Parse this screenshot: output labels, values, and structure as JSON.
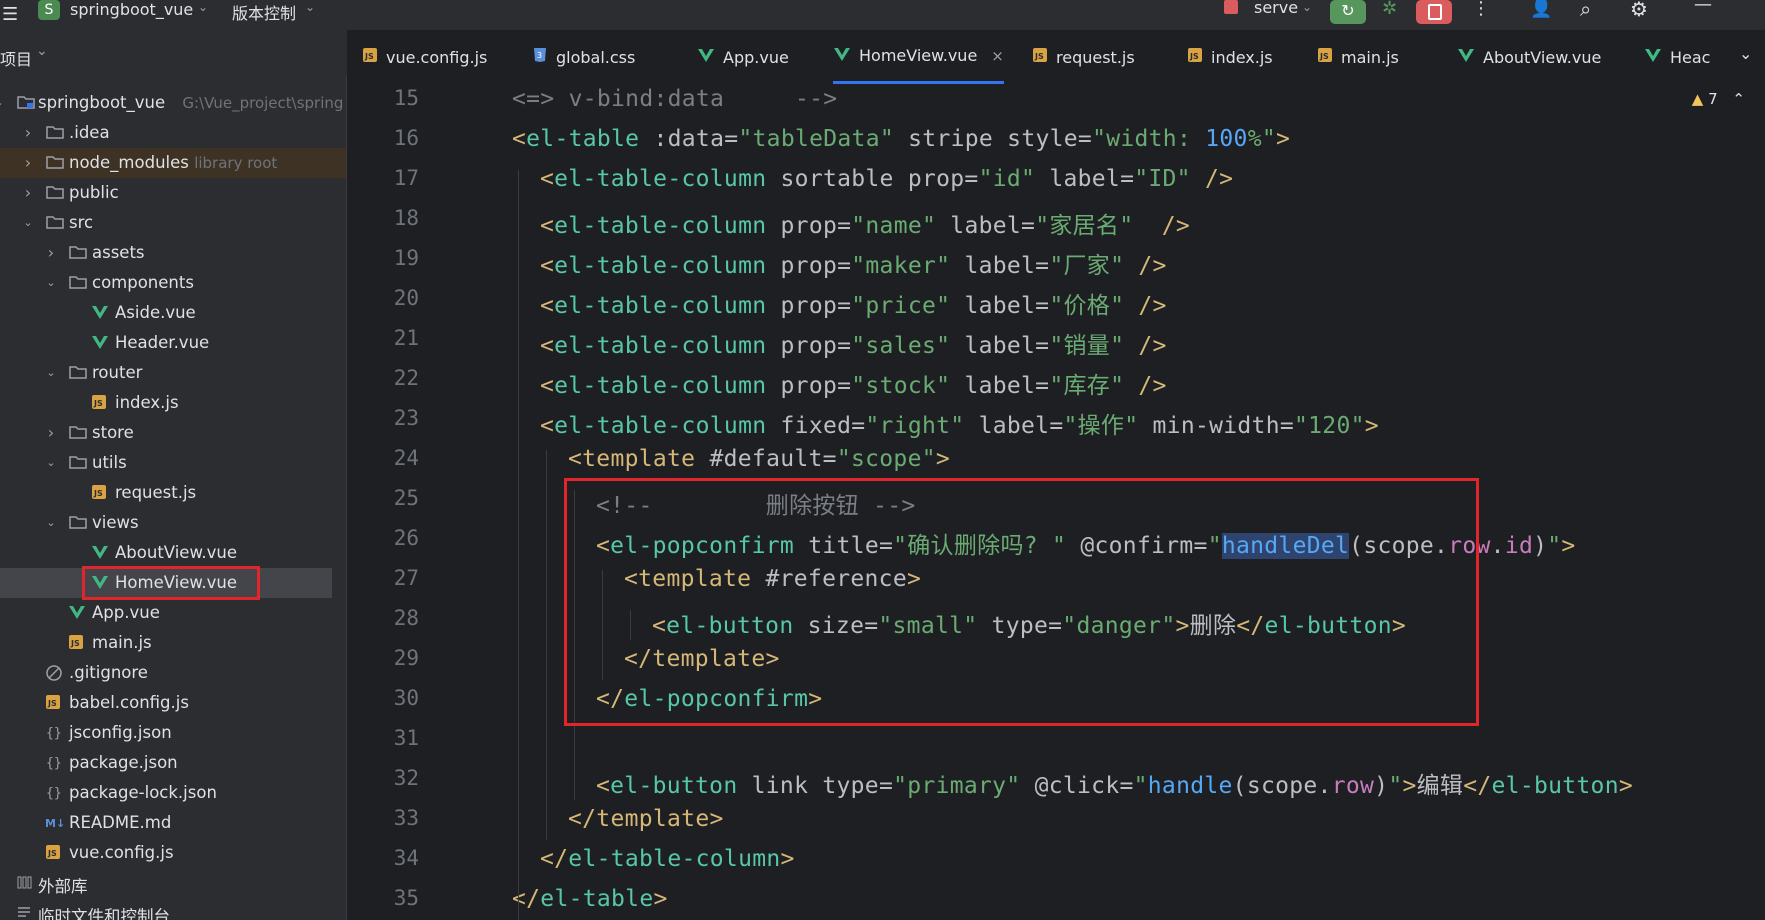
{
  "titlebar": {
    "project_badge": "S",
    "project_name": "springboot_vue",
    "vcs_label": "版本控制",
    "run_config": "serve"
  },
  "panel": {
    "title": "项目"
  },
  "tabs": [
    {
      "label": "vue.config.js",
      "icon": "js"
    },
    {
      "label": "global.css",
      "icon": "css"
    },
    {
      "label": "App.vue",
      "icon": "vue"
    },
    {
      "label": "HomeView.vue",
      "icon": "vue",
      "active": true
    },
    {
      "label": "request.js",
      "icon": "js"
    },
    {
      "label": "index.js",
      "icon": "js"
    },
    {
      "label": "main.js",
      "icon": "js"
    },
    {
      "label": "AboutView.vue",
      "icon": "vue"
    },
    {
      "label": "Heac",
      "icon": "vue"
    }
  ],
  "tree": [
    {
      "label": "springboot_vue",
      "hint": "G:\\Vue_project\\spring",
      "icon": "module",
      "depth": 0,
      "chev": "open"
    },
    {
      "label": ".idea",
      "icon": "folder",
      "depth": 1,
      "chev": "closed"
    },
    {
      "label": "node_modules",
      "hint": "library root",
      "icon": "folder",
      "depth": 1,
      "chev": "closed",
      "excluded": true
    },
    {
      "label": "public",
      "icon": "folder",
      "depth": 1,
      "chev": "closed"
    },
    {
      "label": "src",
      "icon": "folder",
      "depth": 1,
      "chev": "open"
    },
    {
      "label": "assets",
      "icon": "folder",
      "depth": 2,
      "chev": "closed"
    },
    {
      "label": "components",
      "icon": "folder",
      "depth": 2,
      "chev": "open"
    },
    {
      "label": "Aside.vue",
      "icon": "vue",
      "depth": 3
    },
    {
      "label": "Header.vue",
      "icon": "vue",
      "depth": 3
    },
    {
      "label": "router",
      "icon": "folder",
      "depth": 2,
      "chev": "open"
    },
    {
      "label": "index.js",
      "icon": "js",
      "depth": 3
    },
    {
      "label": "store",
      "icon": "folder",
      "depth": 2,
      "chev": "closed"
    },
    {
      "label": "utils",
      "icon": "folder",
      "depth": 2,
      "chev": "open"
    },
    {
      "label": "request.js",
      "icon": "js",
      "depth": 3
    },
    {
      "label": "views",
      "icon": "folder",
      "depth": 2,
      "chev": "open"
    },
    {
      "label": "AboutView.vue",
      "icon": "vue",
      "depth": 3
    },
    {
      "label": "HomeView.vue",
      "icon": "vue",
      "depth": 3,
      "selected": true
    },
    {
      "label": "App.vue",
      "icon": "vue",
      "depth": 2
    },
    {
      "label": "main.js",
      "icon": "js",
      "depth": 2
    },
    {
      "label": ".gitignore",
      "icon": "ignore",
      "depth": 1
    },
    {
      "label": "babel.config.js",
      "icon": "js",
      "depth": 1
    },
    {
      "label": "jsconfig.json",
      "icon": "json",
      "depth": 1
    },
    {
      "label": "package.json",
      "icon": "json",
      "depth": 1
    },
    {
      "label": "package-lock.json",
      "icon": "json",
      "depth": 1
    },
    {
      "label": "README.md",
      "icon": "md",
      "depth": 1
    },
    {
      "label": "vue.config.js",
      "icon": "js",
      "depth": 1
    },
    {
      "label": "外部库",
      "icon": "lib",
      "depth": 0
    },
    {
      "label": "临时文件和控制台",
      "icon": "scratch",
      "depth": 0
    }
  ],
  "editor": {
    "warnings": "7",
    "lines": [
      {
        "n": "15",
        "indent": 0,
        "tokens": [
          [
            "c-cm",
            "<=> v-bind:data     -->"
          ]
        ]
      },
      {
        "n": "16",
        "indent": 0,
        "tokens": [
          [
            "c-tag",
            "<"
          ],
          [
            "c-el",
            "el-table"
          ],
          [
            "c-attr",
            " :data="
          ],
          [
            "c-str",
            "\"tableData\""
          ],
          [
            "c-attr",
            " stripe style="
          ],
          [
            "c-str",
            "\"width: "
          ],
          [
            "c-kw",
            "100"
          ],
          [
            "c-str",
            "%\""
          ],
          [
            "c-tag",
            ">"
          ]
        ]
      },
      {
        "n": "17",
        "indent": 1,
        "tokens": [
          [
            "c-tag",
            "<"
          ],
          [
            "c-el",
            "el-table-column"
          ],
          [
            "c-attr",
            " sortable prop="
          ],
          [
            "c-str",
            "\"id\""
          ],
          [
            "c-attr",
            " label="
          ],
          [
            "c-str",
            "\"ID\""
          ],
          [
            "c-attr",
            " "
          ],
          [
            "c-tag",
            "/>"
          ]
        ]
      },
      {
        "n": "18",
        "indent": 1,
        "tokens": [
          [
            "c-tag",
            "<"
          ],
          [
            "c-el",
            "el-table-column"
          ],
          [
            "c-attr",
            " prop="
          ],
          [
            "c-str",
            "\"name\""
          ],
          [
            "c-attr",
            " label="
          ],
          [
            "c-str",
            "\"家居名\""
          ],
          [
            "c-attr",
            "  "
          ],
          [
            "c-tag",
            "/>"
          ]
        ]
      },
      {
        "n": "19",
        "indent": 1,
        "tokens": [
          [
            "c-tag",
            "<"
          ],
          [
            "c-el",
            "el-table-column"
          ],
          [
            "c-attr",
            " prop="
          ],
          [
            "c-str",
            "\"maker\""
          ],
          [
            "c-attr",
            " label="
          ],
          [
            "c-str",
            "\"厂家\""
          ],
          [
            "c-attr",
            " "
          ],
          [
            "c-tag",
            "/>"
          ]
        ]
      },
      {
        "n": "20",
        "indent": 1,
        "tokens": [
          [
            "c-tag",
            "<"
          ],
          [
            "c-el",
            "el-table-column"
          ],
          [
            "c-attr",
            " prop="
          ],
          [
            "c-str",
            "\"price\""
          ],
          [
            "c-attr",
            " label="
          ],
          [
            "c-str",
            "\"价格\""
          ],
          [
            "c-attr",
            " "
          ],
          [
            "c-tag",
            "/>"
          ]
        ]
      },
      {
        "n": "21",
        "indent": 1,
        "tokens": [
          [
            "c-tag",
            "<"
          ],
          [
            "c-el",
            "el-table-column"
          ],
          [
            "c-attr",
            " prop="
          ],
          [
            "c-str",
            "\"sales\""
          ],
          [
            "c-attr",
            " label="
          ],
          [
            "c-str",
            "\"销量\""
          ],
          [
            "c-attr",
            " "
          ],
          [
            "c-tag",
            "/>"
          ]
        ]
      },
      {
        "n": "22",
        "indent": 1,
        "tokens": [
          [
            "c-tag",
            "<"
          ],
          [
            "c-el",
            "el-table-column"
          ],
          [
            "c-attr",
            " prop="
          ],
          [
            "c-str",
            "\"stock\""
          ],
          [
            "c-attr",
            " label="
          ],
          [
            "c-str",
            "\"库存\""
          ],
          [
            "c-attr",
            " "
          ],
          [
            "c-tag",
            "/>"
          ]
        ]
      },
      {
        "n": "23",
        "indent": 1,
        "tokens": [
          [
            "c-tag",
            "<"
          ],
          [
            "c-el",
            "el-table-column"
          ],
          [
            "c-attr",
            " fixed="
          ],
          [
            "c-str",
            "\"right\""
          ],
          [
            "c-attr",
            " label="
          ],
          [
            "c-str",
            "\"操作\""
          ],
          [
            "c-attr",
            " min-width="
          ],
          [
            "c-str",
            "\"120\""
          ],
          [
            "c-tag",
            ">"
          ]
        ]
      },
      {
        "n": "24",
        "indent": 2,
        "tokens": [
          [
            "c-tag",
            "<"
          ],
          [
            "c-tag",
            "template"
          ],
          [
            "c-attr",
            " #default="
          ],
          [
            "c-str",
            "\"scope\""
          ],
          [
            "c-tag",
            ">"
          ]
        ]
      },
      {
        "n": "25",
        "indent": 3,
        "tokens": [
          [
            "c-cm",
            "<!--        删除按钮 -->"
          ]
        ]
      },
      {
        "n": "26",
        "indent": 3,
        "tokens": [
          [
            "c-tag",
            "<"
          ],
          [
            "c-el",
            "el-popconfirm"
          ],
          [
            "c-attr",
            " title="
          ],
          [
            "c-str",
            "\"确认删除吗? \""
          ],
          [
            "c-attr",
            " @confirm="
          ],
          [
            "c-str",
            "\""
          ],
          [
            "c-fn hl",
            "handleDel"
          ],
          [
            "c-attr",
            "(scope."
          ],
          [
            "c-pr",
            "row"
          ],
          [
            "c-attr",
            "."
          ],
          [
            "c-pr",
            "id"
          ],
          [
            "c-attr",
            ")"
          ],
          [
            "c-str",
            "\""
          ],
          [
            "c-tag",
            ">"
          ]
        ]
      },
      {
        "n": "27",
        "indent": 4,
        "tokens": [
          [
            "c-tag",
            "<"
          ],
          [
            "c-tag",
            "template"
          ],
          [
            "c-attr",
            " #reference"
          ],
          [
            "c-tag",
            ">"
          ]
        ]
      },
      {
        "n": "28",
        "indent": 5,
        "tokens": [
          [
            "c-tag",
            "<"
          ],
          [
            "c-el",
            "el-button"
          ],
          [
            "c-attr",
            " size="
          ],
          [
            "c-str",
            "\"small\""
          ],
          [
            "c-attr",
            " type="
          ],
          [
            "c-str",
            "\"danger\""
          ],
          [
            "c-tag",
            ">"
          ],
          [
            "c-attr",
            "删除"
          ],
          [
            "c-tag",
            "</"
          ],
          [
            "c-el",
            "el-button"
          ],
          [
            "c-tag",
            ">"
          ]
        ]
      },
      {
        "n": "29",
        "indent": 4,
        "tokens": [
          [
            "c-tag",
            "</"
          ],
          [
            "c-tag",
            "template"
          ],
          [
            "c-tag",
            ">"
          ]
        ]
      },
      {
        "n": "30",
        "indent": 3,
        "tokens": [
          [
            "c-tag",
            "</"
          ],
          [
            "c-el",
            "el-popconfirm"
          ],
          [
            "c-tag",
            ">"
          ]
        ]
      },
      {
        "n": "31",
        "indent": 0,
        "tokens": []
      },
      {
        "n": "32",
        "indent": 3,
        "tokens": [
          [
            "c-tag",
            "<"
          ],
          [
            "c-el",
            "el-button"
          ],
          [
            "c-attr",
            " link type="
          ],
          [
            "c-str",
            "\"primary\""
          ],
          [
            "c-attr",
            " @click="
          ],
          [
            "c-str",
            "\""
          ],
          [
            "c-fn",
            "handle"
          ],
          [
            "c-attr",
            "(scope."
          ],
          [
            "c-pr",
            "row"
          ],
          [
            "c-attr",
            ")"
          ],
          [
            "c-str",
            "\""
          ],
          [
            "c-tag",
            ">"
          ],
          [
            "c-attr",
            "编辑"
          ],
          [
            "c-tag",
            "</"
          ],
          [
            "c-el",
            "el-button"
          ],
          [
            "c-tag",
            ">"
          ]
        ]
      },
      {
        "n": "33",
        "indent": 2,
        "tokens": [
          [
            "c-tag",
            "</"
          ],
          [
            "c-tag",
            "template"
          ],
          [
            "c-tag",
            ">"
          ]
        ]
      },
      {
        "n": "34",
        "indent": 1,
        "tokens": [
          [
            "c-tag",
            "</"
          ],
          [
            "c-el",
            "el-table-column"
          ],
          [
            "c-tag",
            ">"
          ]
        ]
      },
      {
        "n": "35",
        "indent": 0,
        "tokens": [
          [
            "c-tag",
            "</"
          ],
          [
            "c-el",
            "el-table"
          ],
          [
            "c-tag",
            ">"
          ]
        ]
      }
    ]
  },
  "colors": {
    "accent": "#3574f0",
    "highlight_box": "#e0262b",
    "run_button": "#57965c",
    "stop_button": "#db5c5c"
  }
}
